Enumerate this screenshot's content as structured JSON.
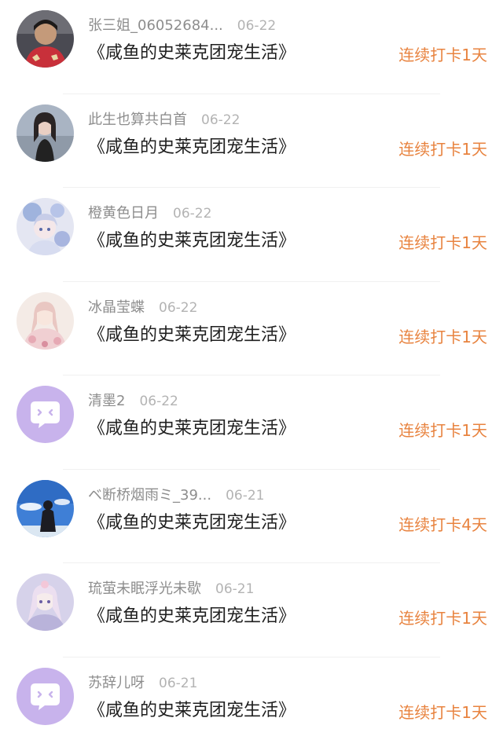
{
  "records": [
    {
      "name": "张三姐_06052684...",
      "date": "06-22",
      "book": "《咸鱼的史莱克团宠生活》",
      "streak": "连续打卡1天",
      "avatar": "photo-woman-red-avatar"
    },
    {
      "name": "此生也算共白首",
      "date": "06-22",
      "book": "《咸鱼的史莱克团宠生活》",
      "streak": "连续打卡1天",
      "avatar": "photo-girl-beach-avatar"
    },
    {
      "name": "橙黄色日月",
      "date": "06-22",
      "book": "《咸鱼的史莱克团宠生活》",
      "streak": "连续打卡1天",
      "avatar": "anime-blue-avatar"
    },
    {
      "name": "冰晶莹蝶",
      "date": "06-22",
      "book": "《咸鱼的史莱克团宠生活》",
      "streak": "连续打卡1天",
      "avatar": "anime-pink-avatar"
    },
    {
      "name": "清墨2",
      "date": "06-22",
      "book": "《咸鱼的史莱克团宠生活》",
      "streak": "连续打卡1天",
      "avatar": "default-chat-avatar"
    },
    {
      "name": "ベ断桥烟雨ミ_39...",
      "date": "06-21",
      "book": "《咸鱼的史莱克团宠生活》",
      "streak": "连续打卡4天",
      "avatar": "photo-sky-girl-avatar"
    },
    {
      "name": "琉萤未眠浮光未歇",
      "date": "06-21",
      "book": "《咸鱼的史莱克团宠生活》",
      "streak": "连续打卡1天",
      "avatar": "anime-lavender-avatar"
    },
    {
      "name": "苏辞儿呀",
      "date": "06-21",
      "book": "《咸鱼的史莱克团宠生活》",
      "streak": "连续打卡1天",
      "avatar": "default-chat-avatar"
    }
  ],
  "colors": {
    "streak": "#e8833f",
    "name": "#8d8d8d",
    "date": "#b3b3b3",
    "book": "#1f1f1f",
    "default_avatar_bg": "#c8b3ec"
  }
}
